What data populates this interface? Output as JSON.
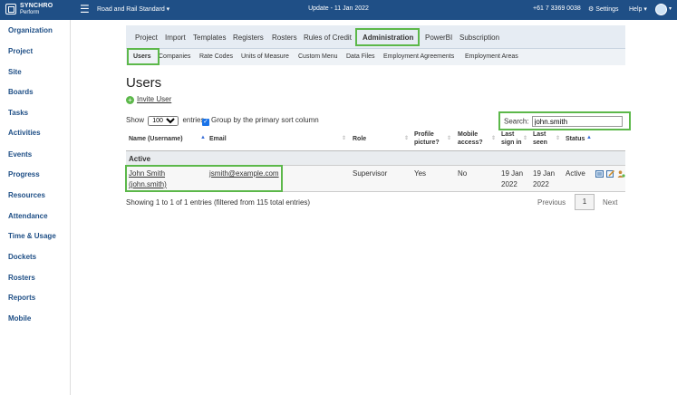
{
  "topbar": {
    "logo_line1": "SYNCHRO",
    "logo_line2": "Perform",
    "company": "Road and Rail Standard",
    "update": "Update - 11 Jan 2022",
    "phone": "+61 7 3369 0038",
    "settings": "Settings",
    "help": "Help",
    "brand_color": "#1f4f86"
  },
  "sidebar": {
    "items": [
      "Organization",
      "Project",
      "Site",
      "Boards",
      "Tasks",
      "Activities",
      "Events",
      "Progress",
      "Resources",
      "Attendance",
      "Time & Usage",
      "Dockets",
      "Rosters",
      "Reports",
      "Mobile"
    ]
  },
  "nav": {
    "main": [
      "Project",
      "Import",
      "Templates",
      "Registers",
      "Rosters",
      "Rules of Credit",
      "Administration",
      "PowerBI",
      "Subscription"
    ],
    "sub": [
      "Users",
      "Companies",
      "Rate Codes",
      "Units of Measure",
      "Custom Menu",
      "Data Files",
      "Employment Agreements",
      "Employment Areas"
    ],
    "highlight_color": "#5cb84a"
  },
  "page": {
    "title": "Users",
    "invite": "Invite User"
  },
  "controls": {
    "show_label": "Show",
    "show_value": "100",
    "entries_label": "entries",
    "group_label": "Group by the primary sort column",
    "search_label": "Search:",
    "search_value": "john.smith"
  },
  "table": {
    "headers": {
      "name": "Name (Username)",
      "email": "Email",
      "role": "Role",
      "profile1": "Profile",
      "profile2": "picture?",
      "mobile1": "Mobile",
      "mobile2": "access?",
      "signin1": "Last",
      "signin2": "sign in",
      "seen1": "Last",
      "seen2": "seen",
      "status": "Status"
    },
    "group": "Active",
    "row": {
      "name": "John Smith",
      "username": "(john.smith)",
      "email": "jsmith@example.com",
      "role": "Supervisor",
      "profile": "Yes",
      "mobile": "No",
      "signin1": "19 Jan",
      "signin2": "2022",
      "seen1": "19 Jan",
      "seen2": "2022",
      "status": "Active"
    }
  },
  "footer": {
    "info": "Showing 1 to 1 of 1 entries (filtered from 115 total entries)",
    "previous": "Previous",
    "page": "1",
    "next": "Next"
  }
}
